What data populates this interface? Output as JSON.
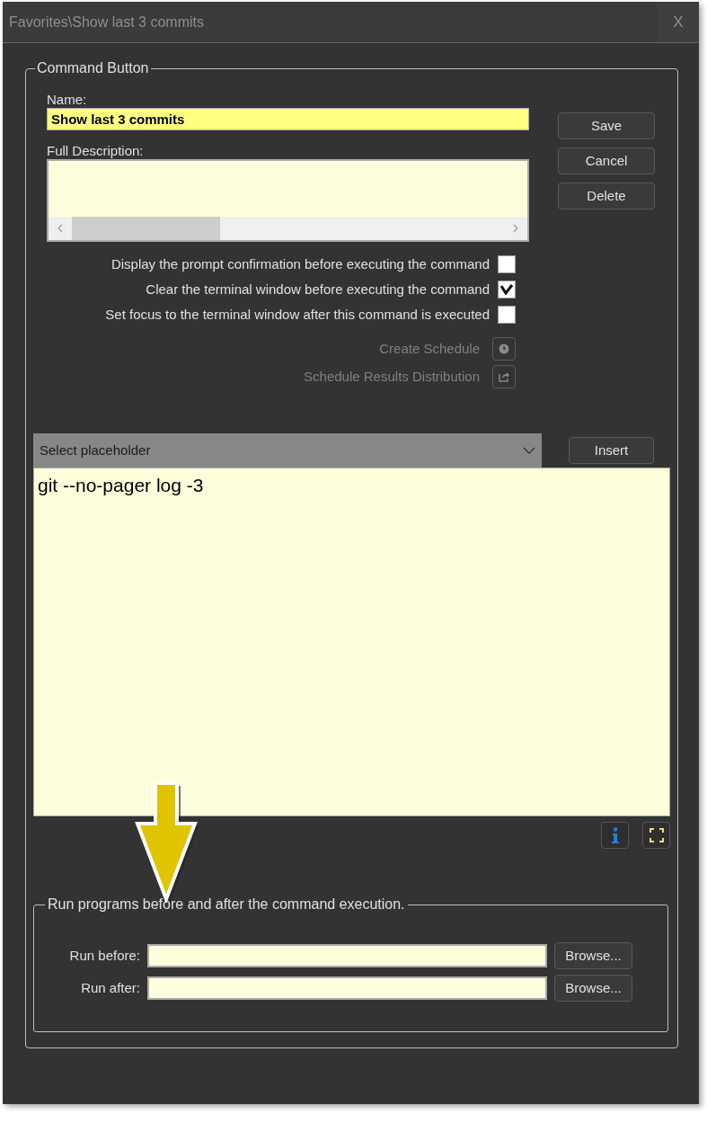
{
  "window": {
    "title": "Favorites\\Show last 3 commits",
    "close": "X"
  },
  "command_group": {
    "legend": "Command Button",
    "name_label": "Name:",
    "name_value": "Show last 3 commits",
    "description_label": "Full Description:",
    "buttons": [
      "Save",
      "Cancel",
      "Delete"
    ],
    "options": [
      {
        "label": "Display the prompt confirmation before executing the command",
        "checked": false
      },
      {
        "label": "Clear the terminal window before executing the command",
        "checked": true
      },
      {
        "label": "Set focus to the terminal window after this command is executed",
        "checked": false
      }
    ],
    "schedule_actions": [
      {
        "label": "Create Schedule",
        "kind": "clock",
        "disabled": true
      },
      {
        "label": "Schedule Results Distribution",
        "kind": "share",
        "disabled": true
      }
    ],
    "placeholder_select": "Select placeholder",
    "insert_button": "Insert",
    "command_text": "git --no-pager log -3"
  },
  "run_group": {
    "legend": "Run programs before and after the command execution.",
    "rows": [
      {
        "label": "Run before:",
        "browse": "Browse..."
      },
      {
        "label": "Run after:",
        "browse": "Browse..."
      }
    ]
  }
}
